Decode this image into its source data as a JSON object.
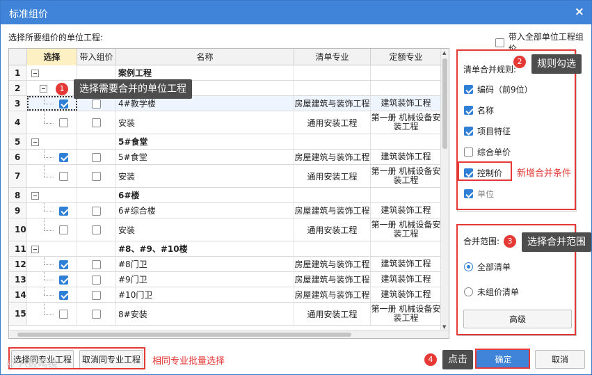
{
  "dialog": {
    "title": "标准组价",
    "close_label": "×"
  },
  "prompt": "选择所要组价的单位工程:",
  "include_all_label": "带入全部单位工程组价",
  "grid": {
    "headers": {
      "select": "选择",
      "bring": "带入组价",
      "name": "名称",
      "spec": "清单专业",
      "quota": "定额专业"
    },
    "rows": [
      {
        "no": "1",
        "name": "案例工程",
        "group": true
      },
      {
        "no": "2",
        "name": "",
        "group": true
      },
      {
        "no": "3",
        "name": "4#教学楼",
        "spec": "房屋建筑与装饰工程",
        "quota": "建筑装饰工程",
        "selected": true
      },
      {
        "no": "4",
        "name": "安装",
        "spec": "通用安装工程",
        "quota": "第一册 机械设备安装工程",
        "selected": false
      },
      {
        "no": "5",
        "name": "5#食堂",
        "group": true
      },
      {
        "no": "6",
        "name": "5#食堂",
        "spec": "房屋建筑与装饰工程",
        "quota": "建筑装饰工程",
        "selected": true
      },
      {
        "no": "7",
        "name": "安装",
        "spec": "通用安装工程",
        "quota": "第一册 机械设备安装工程",
        "selected": false
      },
      {
        "no": "8",
        "name": "6#楼",
        "group": true
      },
      {
        "no": "9",
        "name": "6#综合楼",
        "spec": "房屋建筑与装饰工程",
        "quota": "建筑装饰工程",
        "selected": true
      },
      {
        "no": "10",
        "name": "安装",
        "spec": "通用安装工程",
        "quota": "第一册 机械设备安装工程",
        "selected": false
      },
      {
        "no": "11",
        "name": "#8、#9、#10楼",
        "group": true
      },
      {
        "no": "12",
        "name": "#8门卫",
        "spec": "房屋建筑与装饰工程",
        "quota": "建筑装饰工程",
        "selected": true
      },
      {
        "no": "13",
        "name": "#9门卫",
        "spec": "房屋建筑与装饰工程",
        "quota": "建筑装饰工程",
        "selected": true
      },
      {
        "no": "14",
        "name": "#10门卫",
        "spec": "房屋建筑与装饰工程",
        "quota": "建筑装饰工程",
        "selected": true
      },
      {
        "no": "15",
        "name": "8#安装",
        "spec": "通用安装工程",
        "quota": "第一册 机械设备安装工程",
        "selected": false
      }
    ]
  },
  "rules": {
    "title": "清单合并规则:",
    "options": [
      {
        "label": "编码（前9位）",
        "checked": true
      },
      {
        "label": "名称",
        "checked": true
      },
      {
        "label": "项目特征",
        "checked": true
      },
      {
        "label": "综合单价",
        "checked": false
      },
      {
        "label": "控制价",
        "checked": true
      },
      {
        "label": "单位",
        "checked": true
      }
    ]
  },
  "range": {
    "title": "合并范围:",
    "all_label": "全部清单",
    "unpriced_label": "未组价清单",
    "advanced_label": "高级"
  },
  "buttons": {
    "select_same": "选择同专业工程",
    "cancel_same": "取消同专业工程",
    "ok": "确定",
    "cancel": "取消"
  },
  "annotations": {
    "step1_num": "1",
    "step1_text": "选择需要合并的单位工程",
    "step2_num": "2",
    "step2_text": "规则勾选",
    "step3_num": "3",
    "step3_text": "选择合并范围",
    "step4_num": "4",
    "step4_text": "点击",
    "new_condition": "新增合并条件",
    "batch_select": "相同专业批量选择"
  },
  "watermark": "© 八败鸣镜",
  "colors": {
    "title_bar": "#3f84d8",
    "checkbox": "#2f7fd6",
    "annotation_red": "#e53935",
    "callout_bg": "#4d4d4d"
  }
}
